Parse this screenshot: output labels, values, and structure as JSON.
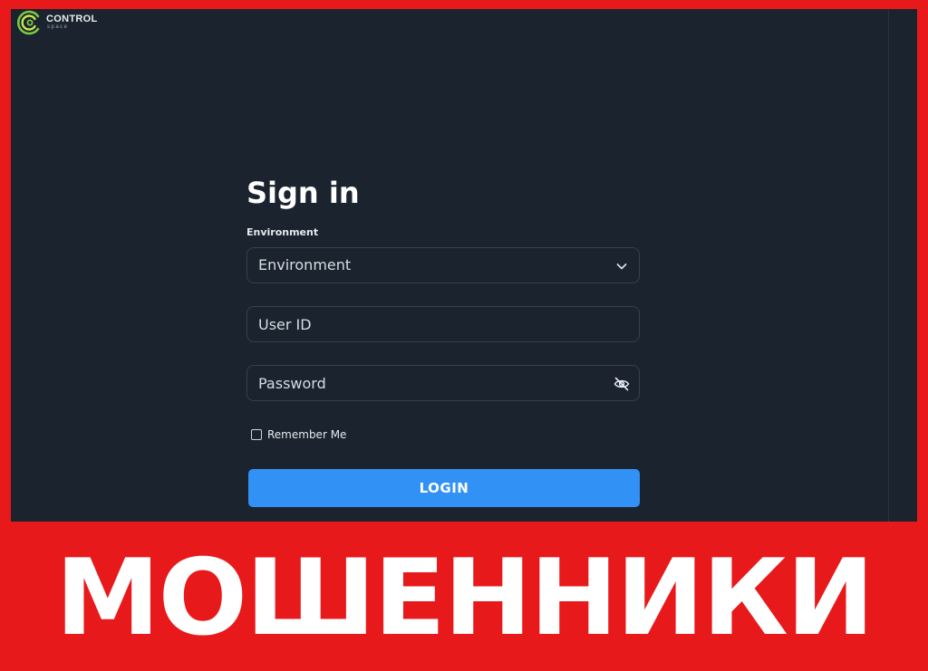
{
  "logo": {
    "name": "CONTROL",
    "sub": "space",
    "colors": {
      "ring_outer": "#7ac943",
      "ring_inner": "#c9e84a"
    }
  },
  "signin": {
    "title": "Sign in",
    "environment_label": "Environment",
    "environment_select": {
      "value": "Environment",
      "icon": "chevron-down-icon"
    },
    "user_id": {
      "placeholder": "User ID",
      "value": ""
    },
    "password": {
      "placeholder": "Password",
      "value": "",
      "icon": "eye-off-icon"
    },
    "remember_me": {
      "label": "Remember Me",
      "checked": false
    },
    "login_button": "LOGIN"
  },
  "banner": {
    "text": "МОШЕННИКИ"
  },
  "colors": {
    "banner_background": "#e8191b",
    "screen_background": "#1a232e",
    "field_border": "#36414d",
    "button": "#3291f5",
    "text": "#ffffff"
  }
}
